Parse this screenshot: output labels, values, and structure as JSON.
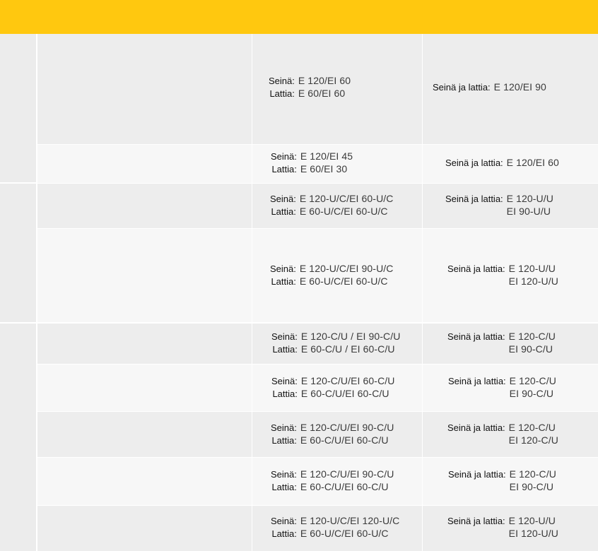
{
  "labels": {
    "wall": "Seinä:",
    "floor": "Lattia:",
    "wall_floor": "Seinä ja lattia:"
  },
  "rows": [
    {
      "wall": "E 120/EI 60",
      "floor": "E 60/EI 60",
      "wall_floor": [
        "E 120/EI 90"
      ]
    },
    {
      "wall": "E 120/EI 45",
      "floor": "E 60/EI 30",
      "wall_floor": [
        "E 120/EI 60"
      ]
    },
    {
      "wall": "E 120-U/C/EI 60-U/C",
      "floor": "E 60-U/C/EI 60-U/C",
      "wall_floor": [
        "E 120-U/U",
        "EI 90-U/U"
      ]
    },
    {
      "wall": "E 120-U/C/EI 90-U/C",
      "floor": "E 60-U/C/EI 60-U/C",
      "wall_floor": [
        "E 120-U/U",
        "EI 120-U/U"
      ]
    },
    {
      "wall": "E 120-C/U / EI 90-C/U",
      "floor": "E 60-C/U / EI 60-C/U",
      "wall_floor": [
        "E 120-C/U",
        "EI 90-C/U"
      ]
    },
    {
      "wall": "E 120-C/U/EI 60-C/U",
      "floor": "E 60-C/U/EI 60-C/U",
      "wall_floor": [
        "E 120-C/U",
        "EI 90-C/U"
      ]
    },
    {
      "wall": "E 120-C/U/EI 90-C/U",
      "floor": "E 60-C/U/EI 60-C/U",
      "wall_floor": [
        "E 120-C/U",
        "EI 120-C/U"
      ]
    },
    {
      "wall": "E 120-C/U/EI 90-C/U",
      "floor": "E 60-C/U/EI 60-C/U",
      "wall_floor": [
        "E 120-C/U",
        "EI 90-C/U"
      ]
    },
    {
      "wall": "E 120-U/C/EI 120-U/C",
      "floor": "E 60-U/C/EI 60-U/C",
      "wall_floor": [
        "E 120-U/U",
        "EI 120-U/U"
      ]
    }
  ]
}
